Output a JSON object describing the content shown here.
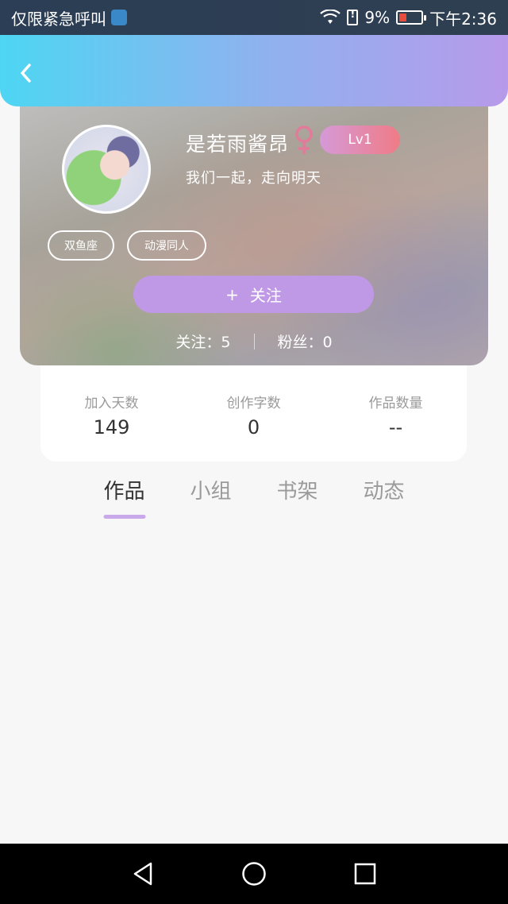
{
  "status_bar": {
    "carrier_text": "仅限紧急呼叫",
    "battery_percent": "9%",
    "time": "下午2:36"
  },
  "header": {
    "back_icon": "chevron-left-icon"
  },
  "profile": {
    "username": "是若雨酱昂",
    "gender_icon": "female-icon",
    "level": "Lv1",
    "signature": "我们一起，走向明天",
    "tags": [
      "双鱼座",
      "动漫同人"
    ],
    "follow_button": {
      "plus": "+",
      "label": "关注"
    },
    "following": "关注：5",
    "followers": "粉丝：0"
  },
  "stats": [
    {
      "label": "加入天数",
      "value": "149"
    },
    {
      "label": "创作字数",
      "value": "0"
    },
    {
      "label": "作品数量",
      "value": "--"
    }
  ],
  "tabs": [
    {
      "label": "作品",
      "active": true
    },
    {
      "label": "小组",
      "active": false
    },
    {
      "label": "书架",
      "active": false
    },
    {
      "label": "动态",
      "active": false
    }
  ],
  "colors": {
    "accent": "#c099e6",
    "header_start": "#4dd6f3",
    "header_end": "#b79aea",
    "female": "#e27a9a"
  }
}
